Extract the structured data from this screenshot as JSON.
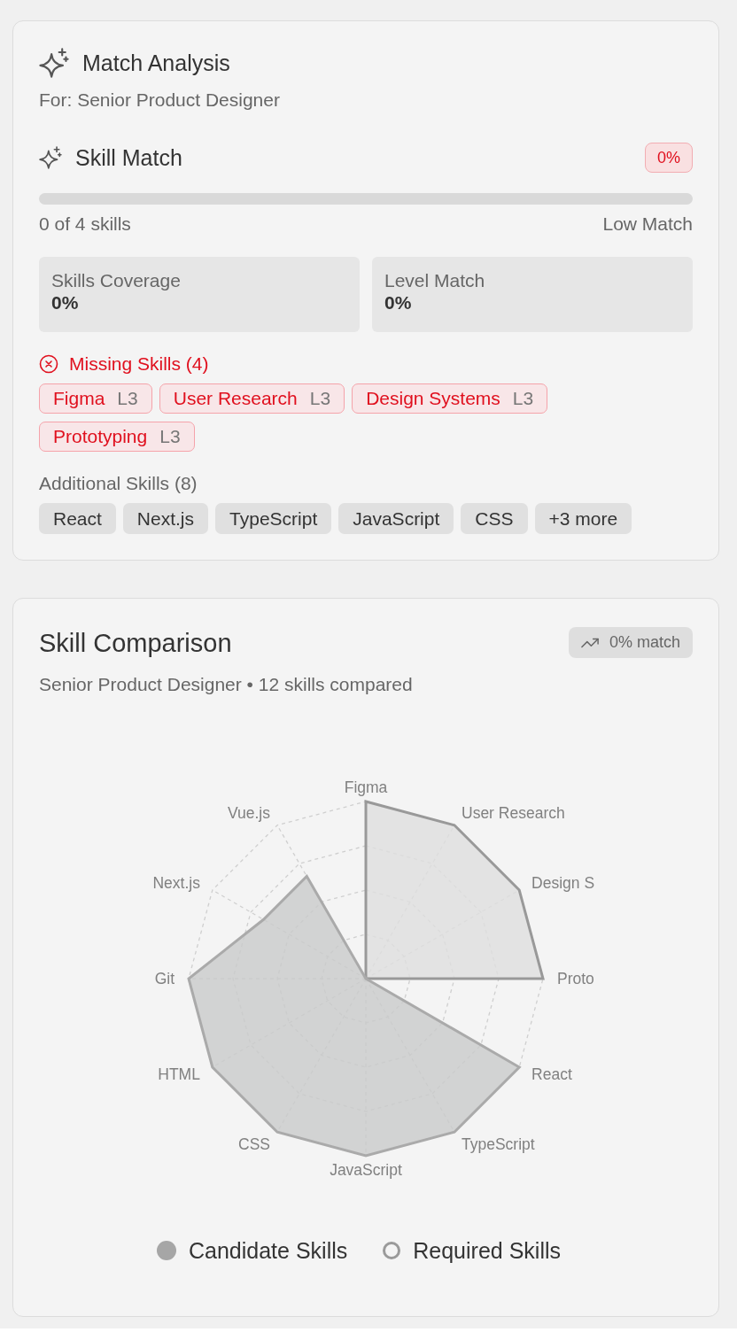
{
  "match_analysis": {
    "title": "Match Analysis",
    "subtitle": "For: Senior Product Designer",
    "skill_match": {
      "title": "Skill Match",
      "badge": "0%",
      "progress": {
        "level": 0
      },
      "count": "0 of 4 skills",
      "rating": "Low Match"
    },
    "stats": [
      {
        "label": "Skills Coverage",
        "value": "0%"
      },
      {
        "label": "Level Match",
        "value": "0%"
      }
    ],
    "missing_skills": {
      "heading": "Missing Skills (4)",
      "items": [
        {
          "name": "Figma",
          "level_tag": "L3"
        },
        {
          "name": "User Research",
          "level_tag": "L3"
        },
        {
          "name": "Design Systems",
          "level_tag": "L3"
        },
        {
          "name": "Prototyping",
          "level_tag": "L3"
        }
      ]
    },
    "additional_skills": {
      "heading": "Additional Skills (8)",
      "items": [
        "React",
        "Next.js",
        "TypeScript",
        "JavaScript",
        "CSS",
        "+3 more"
      ]
    }
  },
  "skill_comparison": {
    "title": "Skill Comparison",
    "badge": "0% match",
    "subtitle": "Senior Product Designer • 12 skills compared",
    "radar": {
      "right_axis_labels": [
        "Figma",
        "User Research",
        "Design S",
        "Proto",
        "React",
        "TypeScript",
        "JavaScript"
      ],
      "left_axis_labels": [
        "Vue.js",
        "Next.js",
        "Git",
        "HTML",
        "CSS"
      ]
    },
    "legend": [
      {
        "label": "Candidate Skills",
        "kind": "filled"
      },
      {
        "label": "Required Skills",
        "kind": "ring"
      }
    ]
  }
}
